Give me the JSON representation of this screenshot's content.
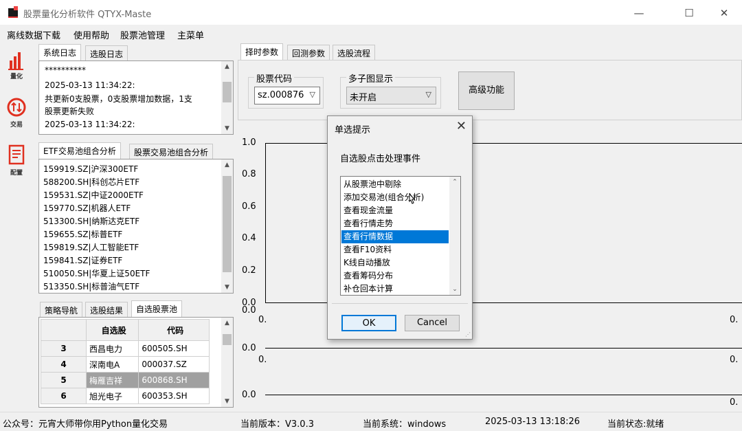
{
  "window": {
    "title": "股票量化分析软件 QTYX-Maste",
    "controls": {
      "minimize": "—",
      "maximize": "☐",
      "close": "✕"
    }
  },
  "menubar": [
    "离线数据下载",
    "使用帮助",
    "股票池管理",
    "主菜单"
  ],
  "leftbar": [
    {
      "label": "量化",
      "icon": "bar-chart-icon"
    },
    {
      "label": "交易",
      "icon": "trade-icon"
    },
    {
      "label": "配置",
      "icon": "config-doc-icon"
    }
  ],
  "log_tabs": [
    "系统日志",
    "选股日志"
  ],
  "log_lines": [
    "**********",
    "2025-03-13 11:34:22:",
    "共更新0支股票，0支股票增加数据，1支",
    "股票更新失败",
    "2025-03-13 11:34:22:"
  ],
  "etf_tabs": [
    "ETF交易池组合分析",
    "股票交易池组合分析"
  ],
  "etf_list": [
    "159919.SZ|沪深300ETF",
    "588200.SH|科创芯片ETF",
    "159531.SZ|中证2000ETF",
    "159770.SZ|机器人ETF",
    "513300.SH|纳斯达克ETF",
    "159655.SZ|标普ETF",
    "159819.SZ|人工智能ETF",
    "159841.SZ|证券ETF",
    "510050.SH|华夏上证50ETF",
    "513350.SH|标普油气ETF"
  ],
  "pool_tabs": [
    "策略导航",
    "选股结果",
    "自选股票池"
  ],
  "pool_table": {
    "headers": [
      "自选股",
      "代码"
    ],
    "rows": [
      {
        "n": "3",
        "name": "西昌电力",
        "code": "600505.SH"
      },
      {
        "n": "4",
        "name": "深南电A",
        "code": "000037.SZ"
      },
      {
        "n": "5",
        "name": "梅雁吉祥",
        "code": "600868.SH"
      },
      {
        "n": "6",
        "name": "旭光电子",
        "code": "600353.SH"
      }
    ]
  },
  "right_tabs": [
    "择时参数",
    "回测参数",
    "选股流程"
  ],
  "stock_code": {
    "label": "股票代码",
    "value": "sz.000876"
  },
  "subplot": {
    "label": "多子图显示",
    "value": "未开启"
  },
  "advanced_button": "高级功能",
  "chart_ticks": {
    "top": [
      "1.0",
      "0.8",
      "0.6",
      "0.4",
      "0.2",
      "0.0"
    ],
    "zero": "0.0",
    "partial": "0."
  },
  "dialog": {
    "title": "单选提示",
    "message": "自选股点击处理事件",
    "options": [
      "从股票池中剔除",
      "添加交易池(组合分析)",
      "查看现金流量",
      "查看行情走势",
      "查看行情数据",
      "查看F10资料",
      "K线自动播放",
      "查看筹码分布",
      "补仓回本计算"
    ],
    "selected": "查看行情数据",
    "ok": "OK",
    "cancel": "Cancel"
  },
  "statusbar": [
    "公众号：元宵大师带你用Python量化交易",
    "当前版本：V3.0.3",
    "当前系统：windows",
    "2025-03-13 13:18:26",
    "当前状态:就绪"
  ]
}
